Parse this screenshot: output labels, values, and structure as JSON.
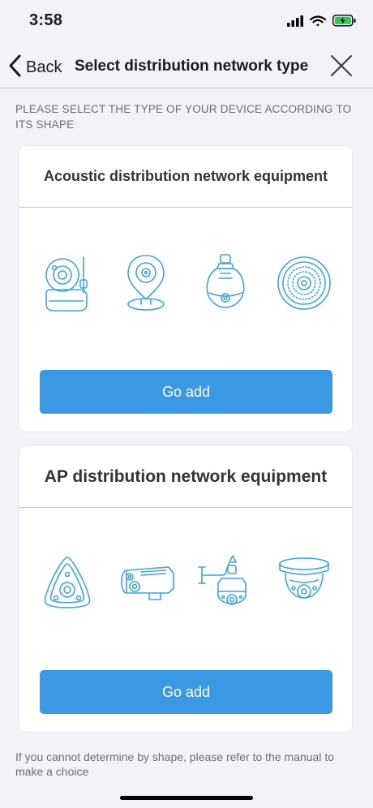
{
  "status": {
    "time": "3:58",
    "icons": [
      "cellular-signal-icon",
      "wifi-icon",
      "battery-charging-icon"
    ],
    "battery_color": "#32c759"
  },
  "nav": {
    "back_label": "Back",
    "title": "Select distribution network type",
    "close_icon": "close-icon"
  },
  "instruction": "PLEASE SELECT THE TYPE OF YOUR DEVICE ACCORDING TO ITS SHAPE",
  "sections": [
    {
      "title": "Acoustic distribution network equipment",
      "devices": [
        "robot-camera-icon",
        "pin-camera-icon",
        "bulb-camera-icon",
        "round-camera-icon"
      ],
      "button_label": "Go add"
    },
    {
      "title": "AP distribution network equipment",
      "devices": [
        "panoramic-camera-icon",
        "bullet-camera-icon",
        "ptz-camera-icon",
        "dome-camera-icon"
      ],
      "button_label": "Go add"
    }
  ],
  "footnote": "If you cannot determine by shape, please refer to the manual to make a choice",
  "colors": {
    "accent": "#3b99e4",
    "icon_line": "#3ea6dc",
    "background": "#f2f2f7"
  }
}
